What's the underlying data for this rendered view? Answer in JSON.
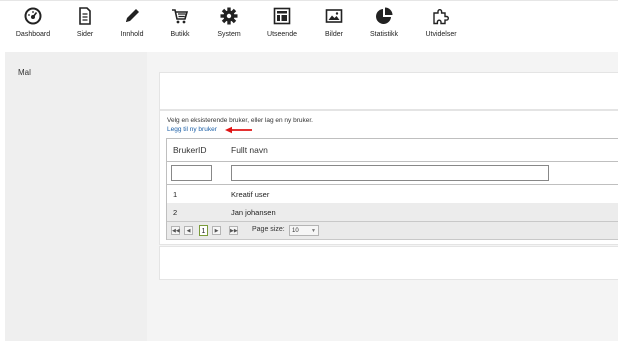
{
  "nav": [
    {
      "label": "Dashboard",
      "icon": "dashboard-icon"
    },
    {
      "label": "Sider",
      "icon": "page-icon"
    },
    {
      "label": "Innhold",
      "icon": "pencil-icon"
    },
    {
      "label": "Butikk",
      "icon": "cart-icon"
    },
    {
      "label": "System",
      "icon": "gear-icon"
    },
    {
      "label": "Utseende",
      "icon": "layout-icon"
    },
    {
      "label": "Bilder",
      "icon": "image-icon"
    },
    {
      "label": "Statistikk",
      "icon": "pie-chart-icon"
    },
    {
      "label": "Utvidelser",
      "icon": "puzzle-icon"
    }
  ],
  "sidebar": {
    "items": [
      {
        "label": "Mal"
      }
    ]
  },
  "content": {
    "intro": "Velg en eksisterende bruker, eller lag en ny bruker.",
    "add_link": "Legg til ny bruker"
  },
  "grid": {
    "columns": [
      "BrukerID",
      "Fullt navn"
    ],
    "filters": [
      "",
      ""
    ],
    "rows": [
      {
        "id": "1",
        "name": "Kreatif user"
      },
      {
        "id": "2",
        "name": "Jan johansen"
      }
    ],
    "pager": {
      "first": "◀◀",
      "prev": "◀",
      "current_page": "1",
      "next": "▶",
      "last": "▶▶",
      "page_size_label": "Page size:",
      "page_size": "10"
    }
  },
  "colors": {
    "link": "#1a5ea6",
    "arrow": "#e01515",
    "sidebar_bg": "#efefef",
    "main_bg": "#f4f4f4"
  }
}
